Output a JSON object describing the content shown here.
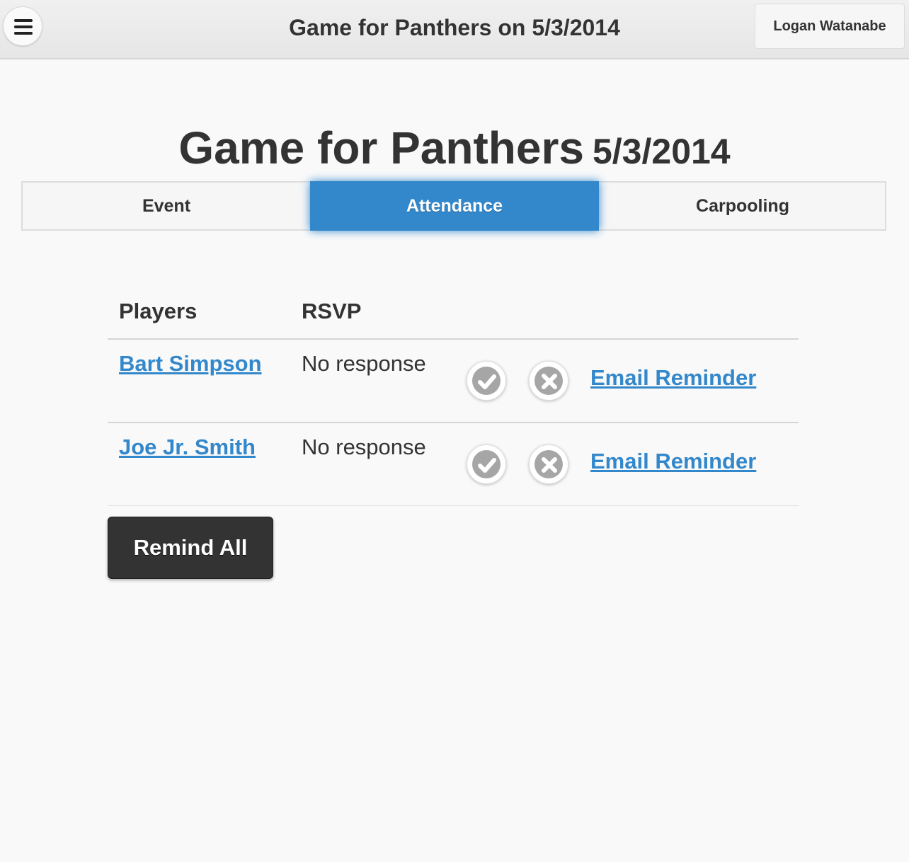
{
  "header": {
    "title": "Game for Panthers on 5/3/2014",
    "menu_icon": "hamburger-menu-icon",
    "user_button": "Logan Watanabe"
  },
  "page": {
    "title": "Game for Panthers",
    "date": "5/3/2014"
  },
  "tabs": [
    {
      "label": "Event",
      "active": false
    },
    {
      "label": "Attendance",
      "active": true
    },
    {
      "label": "Carpooling",
      "active": false
    }
  ],
  "table": {
    "headers": [
      "Players",
      "RSVP"
    ],
    "rows": [
      {
        "player": "Bart Simpson",
        "rsvp": "No response",
        "action": "Email Reminder"
      },
      {
        "player": "Joe Jr. Smith",
        "rsvp": "No response",
        "action": "Email Reminder"
      }
    ]
  },
  "actions": {
    "remind_all": "Remind All"
  },
  "colors": {
    "accent": "#3388cc",
    "dark_button": "#333333",
    "background": "#f9f9f9",
    "icon_gray": "#a6a6a6"
  },
  "icons": [
    "hamburger-menu-icon",
    "check-icon",
    "close-icon"
  ]
}
